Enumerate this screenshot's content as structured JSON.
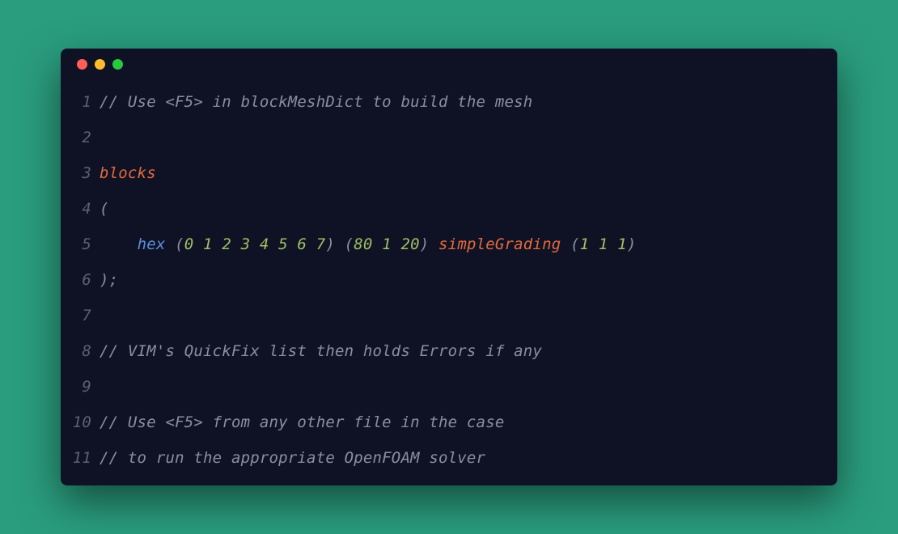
{
  "colors": {
    "background": "#2a9d7e",
    "editor_bg": "#0f1224",
    "traffic_red": "#ff5f56",
    "traffic_yellow": "#ffbd2e",
    "traffic_green": "#27c93f",
    "comment": "#8a8f9e",
    "keyword": "#e36a3d",
    "type": "#5c8ddb",
    "number": "#9fc062",
    "punct": "#8a8f9e",
    "gutter": "#5b6072"
  },
  "lines": {
    "l1": {
      "n": "1",
      "c": "// Use <F5> in blockMeshDict to build the mesh"
    },
    "l2": {
      "n": "2",
      "c": ""
    },
    "l3": {
      "n": "3",
      "kw": "blocks"
    },
    "l4": {
      "n": "4",
      "p": "("
    },
    "l5": {
      "n": "5",
      "indent": "    ",
      "type": "hex",
      "sp1": " ",
      "po1": "(",
      "nums1": "0 1 2 3 4 5 6 7",
      "pc1": ")",
      "sp2": " ",
      "po2": "(",
      "nums2": "80 1 20",
      "pc2": ")",
      "sp3": " ",
      "func": "simpleGrading",
      "sp4": " ",
      "po3": "(",
      "nums3": "1 1 1",
      "pc3": ")"
    },
    "l6": {
      "n": "6",
      "p": ");"
    },
    "l7": {
      "n": "7",
      "c": ""
    },
    "l8": {
      "n": "8",
      "c": "// VIM's QuickFix list then holds Errors if any"
    },
    "l9": {
      "n": "9",
      "c": ""
    },
    "l10": {
      "n": "10",
      "c": "// Use <F5> from any other file in the case"
    },
    "l11": {
      "n": "11",
      "c": "// to run the appropriate OpenFOAM solver"
    }
  }
}
